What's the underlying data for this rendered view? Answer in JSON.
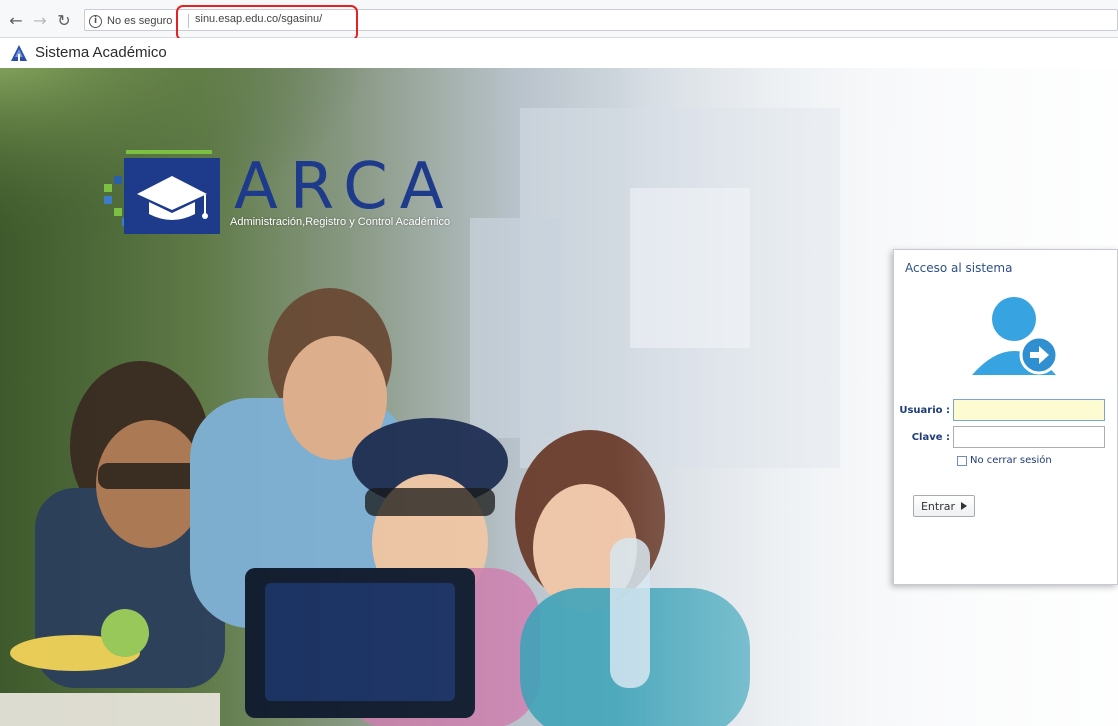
{
  "browser": {
    "security_label": "No es seguro",
    "url": "sinu.esap.edu.co/sgasinu/",
    "icons": {
      "back": "back-arrow-icon",
      "forward": "forward-arrow-icon",
      "reload": "reload-icon",
      "info": "info-icon"
    },
    "highlight_color": "#e32222"
  },
  "app": {
    "title": "Sistema Académico",
    "logo_icon": "triangle-logo-icon"
  },
  "hero": {
    "brand": {
      "name": "ARCA",
      "subtitle": "Administración,Registro y Control Académico",
      "colors": {
        "primary": "#1e3a8a",
        "accent": "#7bc043"
      }
    }
  },
  "login": {
    "title": "Acceso al sistema",
    "avatar_icon": "user-login-icon",
    "username_label": "Usuario :",
    "password_label": "Clave :",
    "keep_session_label": "No cerrar sesión",
    "submit_label": "Entrar",
    "username_value": "",
    "password_value": ""
  }
}
